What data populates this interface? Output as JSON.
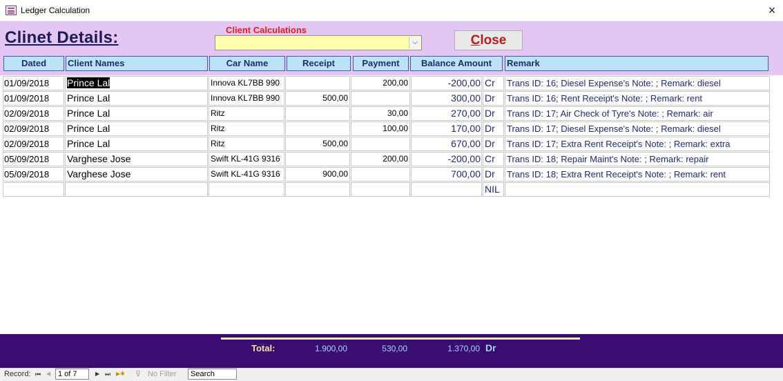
{
  "window": {
    "title": "Ledger Calculation",
    "close_glyph": "×"
  },
  "header": {
    "title": "Clinet Details:",
    "combo_label": "Client Calculations",
    "combo_value": "",
    "combo_arrow": "⌵",
    "close_button_first": "C",
    "close_button_rest": "lose"
  },
  "columns": {
    "dated": "Dated",
    "client": "Client Names",
    "car": "Car Name",
    "receipt": "Receipt",
    "payment": "Payment",
    "balance": "Balance Amount",
    "remark": "Remark"
  },
  "rows": [
    {
      "dated": "01/09/2018",
      "client": "Prince Lal",
      "car": "Innova KL7BB 990",
      "receipt": "",
      "payment": "200,00",
      "balance": "-200,00",
      "drcr": "Cr",
      "remark": "Trans ID: 16;  Diesel Expense's Note: ; Remark:  diesel"
    },
    {
      "dated": "01/09/2018",
      "client": "Prince Lal",
      "car": "Innova KL7BB 990",
      "receipt": "500,00",
      "payment": "",
      "balance": "300,00",
      "drcr": "Dr",
      "remark": "Trans ID: 16;  Rent Receipt's Note: ; Remark:  rent"
    },
    {
      "dated": "02/09/2018",
      "client": "Prince Lal",
      "car": "Ritz",
      "receipt": "",
      "payment": "30,00",
      "balance": "270,00",
      "drcr": "Dr",
      "remark": "Trans ID: 17;  Air Check of Tyre's Note: ; Remark:  air"
    },
    {
      "dated": "02/09/2018",
      "client": "Prince Lal",
      "car": "Ritz",
      "receipt": "",
      "payment": "100,00",
      "balance": "170,00",
      "drcr": "Dr",
      "remark": "Trans ID: 17;  Diesel Expense's Note: ; Remark:  diesel"
    },
    {
      "dated": "02/09/2018",
      "client": "Prince Lal",
      "car": "Ritz",
      "receipt": "500,00",
      "payment": "",
      "balance": "670,00",
      "drcr": "Dr",
      "remark": "Trans ID: 17;  Extra Rent Receipt's Note: ; Remark:  extra"
    },
    {
      "dated": "05/09/2018",
      "client": "Varghese Jose",
      "car": "Swift KL-41G 9316",
      "receipt": "",
      "payment": "200,00",
      "balance": "-200,00",
      "drcr": "Cr",
      "remark": "Trans ID: 18;  Repair Maint's Note: ; Remark:  repair"
    },
    {
      "dated": "05/09/2018",
      "client": "Varghese Jose",
      "car": "Swift KL-41G 9316",
      "receipt": "900,00",
      "payment": "",
      "balance": "700,00",
      "drcr": "Dr",
      "remark": "Trans ID: 18;  Extra Rent Receipt's Note: ; Remark:  rent"
    },
    {
      "dated": "",
      "client": "",
      "car": "",
      "receipt": "",
      "payment": "",
      "balance": "",
      "drcr": "NIL",
      "remark": ""
    }
  ],
  "footer": {
    "total_label": "Total:",
    "receipt_total": "1.900,00",
    "payment_total": "530,00",
    "balance_total": "1.370,00",
    "drcr": "Dr"
  },
  "navigation": {
    "record_label": "Record:",
    "first": "⏮",
    "prev": "◀",
    "record_value": "1 of 7",
    "next": "▶",
    "last": "⏭",
    "new": "▶✱",
    "filter_icon": "⊽",
    "filter_label": "No Filter",
    "search_label": "Search"
  },
  "colors": {
    "header_band": "#e4c6f4",
    "column_header": "#bde3f9",
    "footer": "#3a0c72",
    "combo_bg": "#ffffb0",
    "close_text": "#c0171c"
  }
}
